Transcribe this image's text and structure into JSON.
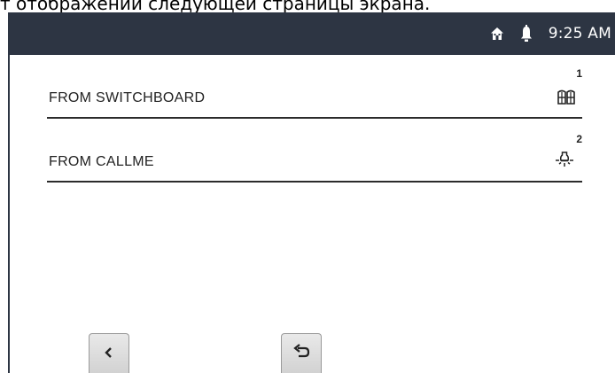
{
  "caption": "т отображении следующей страницы экрана.",
  "status": {
    "time": "9:25 AM",
    "icons": [
      "home-icon",
      "bell-icon"
    ]
  },
  "rows": [
    {
      "label": "FROM SWITCHBOARD",
      "number": "1",
      "icon": "gate-icon"
    },
    {
      "label": "FROM CALLME",
      "number": "2",
      "icon": "light-icon"
    }
  ],
  "nav": {
    "back_icon": "chevron-left-icon",
    "return_icon": "undo-arrow-icon"
  },
  "colors": {
    "statusbar": "#2d3543",
    "divider": "#2b2b2b",
    "button": "#dcdcdc"
  }
}
